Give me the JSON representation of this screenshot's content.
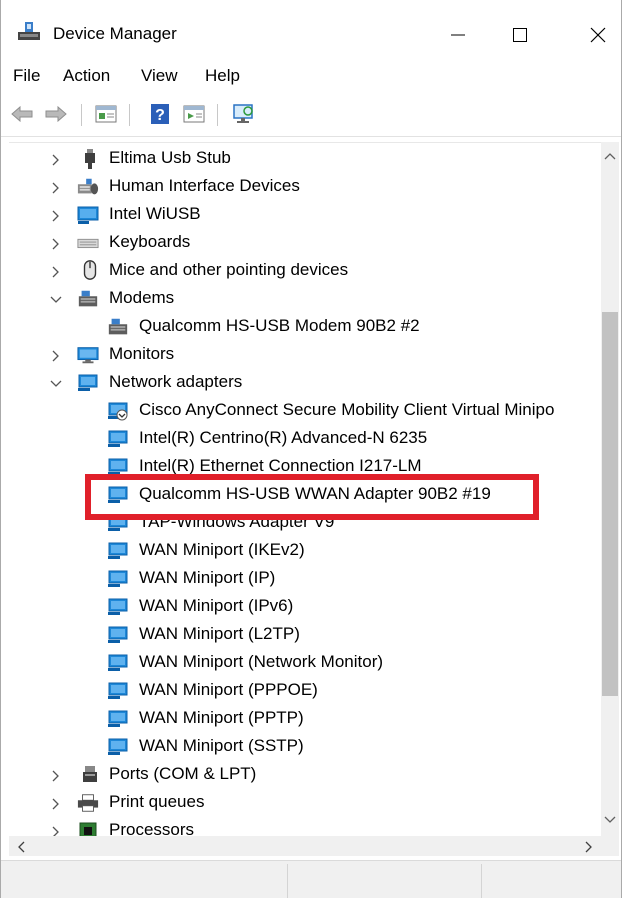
{
  "window": {
    "title": "Device Manager",
    "controls": {
      "minimize": "—",
      "maximize": "☐",
      "close": "✕"
    }
  },
  "menu": [
    "File",
    "Action",
    "View",
    "Help"
  ],
  "toolbar": {
    "buttons": [
      "back-arrow-icon",
      "forward-arrow-icon",
      "properties-icon",
      "help-icon",
      "update-driver-icon",
      "scan-hardware-icon"
    ]
  },
  "tree": [
    {
      "label": "Eltima Usb Stub",
      "expanded": false,
      "level": 0,
      "icon": "usb-stub-icon"
    },
    {
      "label": "Human Interface Devices",
      "expanded": false,
      "level": 0,
      "icon": "hid-icon"
    },
    {
      "label": "Intel WiUSB",
      "expanded": false,
      "level": 0,
      "icon": "monitor-network-icon"
    },
    {
      "label": "Keyboards",
      "expanded": false,
      "level": 0,
      "icon": "keyboard-icon"
    },
    {
      "label": "Mice and other pointing devices",
      "expanded": false,
      "level": 0,
      "icon": "mouse-icon"
    },
    {
      "label": "Modems",
      "expanded": true,
      "level": 0,
      "icon": "modem-icon"
    },
    {
      "label": "Qualcomm HS-USB Modem 90B2 #2",
      "level": 1,
      "icon": "modem-icon"
    },
    {
      "label": "Monitors",
      "expanded": false,
      "level": 0,
      "icon": "monitor-icon"
    },
    {
      "label": "Network adapters",
      "expanded": true,
      "level": 0,
      "icon": "network-adapter-icon"
    },
    {
      "label": "Cisco AnyConnect Secure Mobility Client Virtual Minipo",
      "level": 1,
      "icon": "network-adapter-download-icon"
    },
    {
      "label": "Intel(R) Centrino(R) Advanced-N 6235",
      "level": 1,
      "icon": "network-adapter-icon"
    },
    {
      "label": "Intel(R) Ethernet Connection I217-LM",
      "level": 1,
      "icon": "network-adapter-icon"
    },
    {
      "label": "Qualcomm HS-USB WWAN Adapter 90B2 #19",
      "level": 1,
      "icon": "network-adapter-icon",
      "highlighted": true
    },
    {
      "label": "TAP-Windows Adapter V9",
      "level": 1,
      "icon": "network-adapter-icon"
    },
    {
      "label": "WAN Miniport (IKEv2)",
      "level": 1,
      "icon": "network-adapter-icon"
    },
    {
      "label": "WAN Miniport (IP)",
      "level": 1,
      "icon": "network-adapter-icon"
    },
    {
      "label": "WAN Miniport (IPv6)",
      "level": 1,
      "icon": "network-adapter-icon"
    },
    {
      "label": "WAN Miniport (L2TP)",
      "level": 1,
      "icon": "network-adapter-icon"
    },
    {
      "label": "WAN Miniport (Network Monitor)",
      "level": 1,
      "icon": "network-adapter-icon"
    },
    {
      "label": "WAN Miniport (PPPOE)",
      "level": 1,
      "icon": "network-adapter-icon"
    },
    {
      "label": "WAN Miniport (PPTP)",
      "level": 1,
      "icon": "network-adapter-icon"
    },
    {
      "label": "WAN Miniport (SSTP)",
      "level": 1,
      "icon": "network-adapter-icon"
    },
    {
      "label": "Ports (COM & LPT)",
      "expanded": false,
      "level": 0,
      "icon": "port-icon"
    },
    {
      "label": "Print queues",
      "expanded": false,
      "level": 0,
      "icon": "printer-icon"
    },
    {
      "label": "Processors",
      "expanded": false,
      "level": 0,
      "icon": "processor-icon"
    }
  ],
  "colors": {
    "highlight_border": "#e0202a",
    "adapter_blue": "#1e88d8",
    "adapter_dark": "#0b5fa8"
  }
}
